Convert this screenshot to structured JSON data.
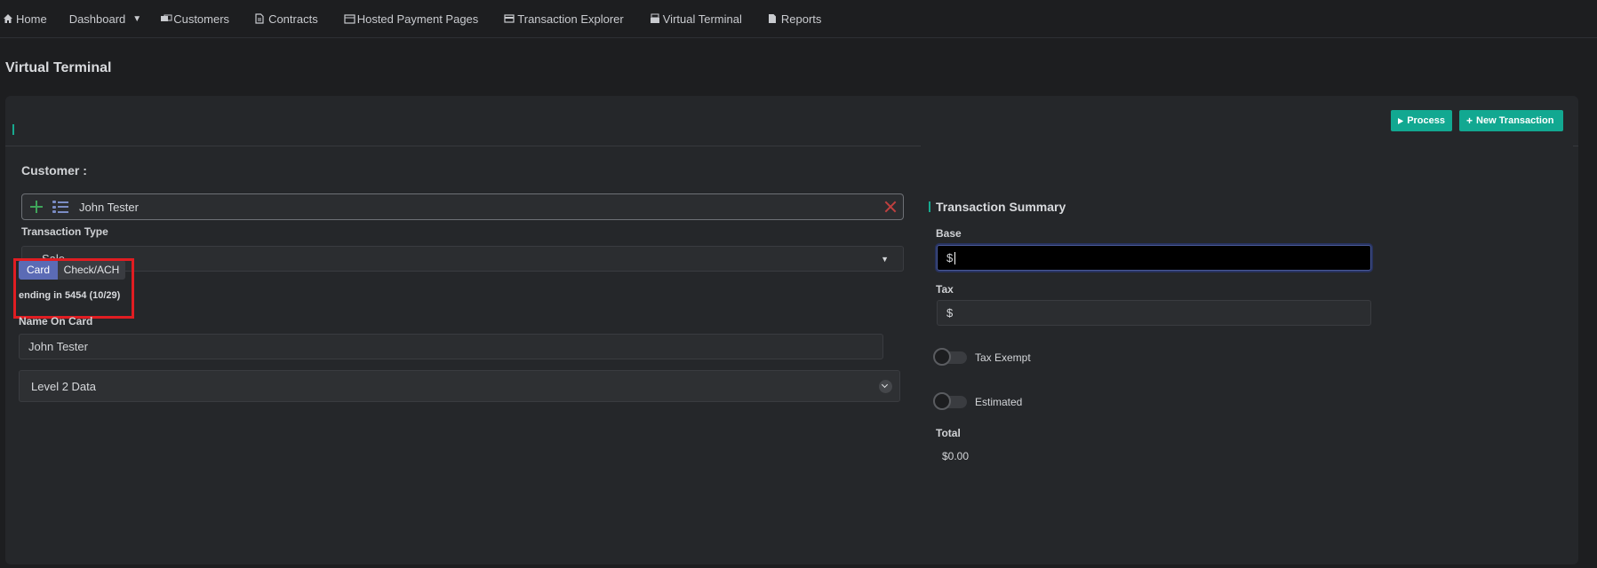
{
  "nav": {
    "items": [
      {
        "label": "Home",
        "icon": "home-icon"
      },
      {
        "label": "Dashboard",
        "icon": "",
        "dropdown": true
      },
      {
        "label": "Customers",
        "icon": "customers-icon"
      },
      {
        "label": "Contracts",
        "icon": "document-icon"
      },
      {
        "label": "Hosted Payment Pages",
        "icon": "pages-icon"
      },
      {
        "label": "Transaction Explorer",
        "icon": "card-icon"
      },
      {
        "label": "Virtual Terminal",
        "icon": "terminal-icon"
      },
      {
        "label": "Reports",
        "icon": "report-icon"
      }
    ]
  },
  "page": {
    "title": "Virtual Terminal"
  },
  "actions": {
    "process_label": "Process",
    "new_transaction_label": "New Transaction"
  },
  "form": {
    "customer_label": "Customer :",
    "customer_value": "John Tester",
    "transaction_type_label": "Transaction Type",
    "transaction_type_value": "Sale",
    "payment_tabs": {
      "card": "Card",
      "check": "Check/ACH",
      "selected": "Card"
    },
    "card_ending": "ending in 5454 (10/29)",
    "name_on_card_label": "Name On Card",
    "name_on_card_value": "John Tester",
    "level2_label": "Level 2 Data"
  },
  "summary": {
    "title": "Transaction Summary",
    "base_label": "Base",
    "base_prefix": "$",
    "tax_label": "Tax",
    "tax_prefix": "$",
    "tax_exempt_label": "Tax Exempt",
    "tax_exempt_on": false,
    "estimated_label": "Estimated",
    "estimated_on": false,
    "total_label": "Total",
    "total_value": "$0.00"
  },
  "colors": {
    "accent": "#12a891",
    "selected_tab": "#5b6bb5",
    "highlight": "#e01d22"
  }
}
